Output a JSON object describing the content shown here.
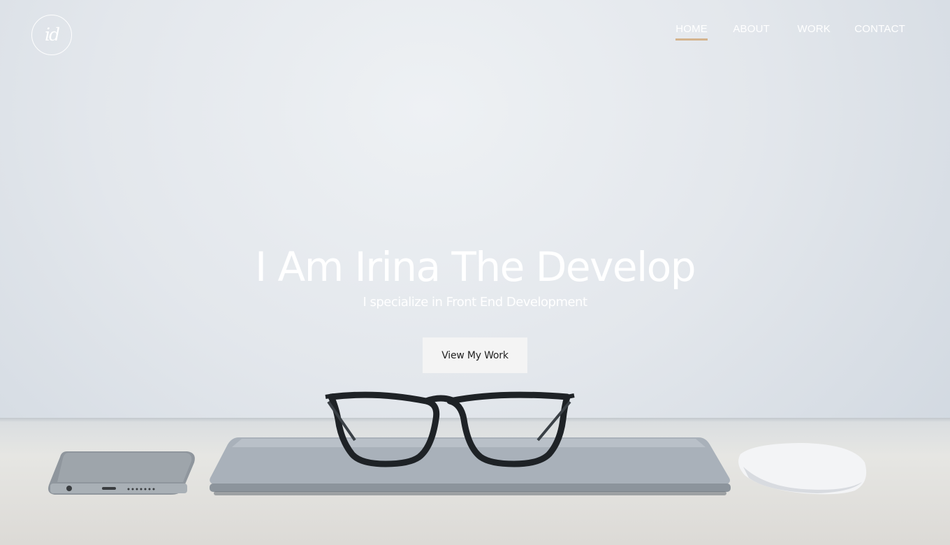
{
  "header": {
    "logo_text": "id",
    "nav": [
      {
        "label": "HOME",
        "active": true
      },
      {
        "label": "ABOUT",
        "active": false
      },
      {
        "label": "WORK",
        "active": false
      },
      {
        "label": "CONTACT",
        "active": false
      }
    ]
  },
  "hero": {
    "headline": "I Am Irina The Develop",
    "subheadline": "I specialize in Front End Development",
    "cta_label": "View My Work"
  },
  "colors": {
    "accent": "#d4b48f",
    "text": "#ffffff",
    "button_bg": "#f4f4f4"
  },
  "icons": [
    "logo-monogram-icon"
  ]
}
